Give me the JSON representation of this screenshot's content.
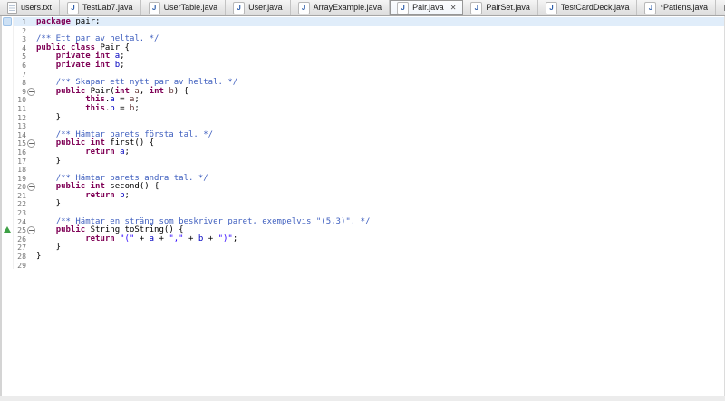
{
  "tabbar": {
    "tabs": [
      {
        "label": "users.txt",
        "icon": "text-file",
        "active": false
      },
      {
        "label": "TestLab7.java",
        "icon": "java-file",
        "active": false
      },
      {
        "label": "UserTable.java",
        "icon": "java-file",
        "active": false
      },
      {
        "label": "User.java",
        "icon": "java-file",
        "active": false
      },
      {
        "label": "ArrayExample.java",
        "icon": "java-file",
        "active": false
      },
      {
        "label": "Pair.java",
        "icon": "java-file",
        "active": true,
        "closable": true
      },
      {
        "label": "PairSet.java",
        "icon": "java-file",
        "active": false
      },
      {
        "label": "TestCardDeck.java",
        "icon": "java-file",
        "active": false
      },
      {
        "label": "*Patiens.java",
        "icon": "java-file",
        "active": false,
        "dirty": true
      }
    ],
    "window_controls": [
      "minimize",
      "maximize"
    ]
  },
  "icons": {
    "java_glyph": "J",
    "close_glyph": "✕"
  },
  "colors": {
    "keyword": "#7f0055",
    "javadoc": "#3f5fbf",
    "string": "#2a00ff",
    "field": "#0000c0",
    "parameter": "#6a3e3e",
    "current_line_highlight": "#e0edfa",
    "line_number": "#777777",
    "override_marker_green": "#3da045"
  },
  "editor": {
    "language": "java",
    "file": "Pair.java",
    "current_line": 1,
    "lines": [
      {
        "n": 1,
        "highlight": true,
        "marker": "edit",
        "tokens": [
          [
            "kw",
            "package"
          ],
          [
            "plain",
            " pair;"
          ]
        ]
      },
      {
        "n": 2,
        "tokens": []
      },
      {
        "n": 3,
        "tokens": [
          [
            "doc",
            "/** Ett par av heltal. */"
          ]
        ]
      },
      {
        "n": 4,
        "tokens": [
          [
            "kw",
            "public"
          ],
          [
            "plain",
            " "
          ],
          [
            "kw",
            "class"
          ],
          [
            "plain",
            " Pair {"
          ]
        ]
      },
      {
        "n": 5,
        "tokens": [
          [
            "plain",
            "    "
          ],
          [
            "kw",
            "private"
          ],
          [
            "plain",
            " "
          ],
          [
            "kw",
            "int"
          ],
          [
            "plain",
            " "
          ],
          [
            "field",
            "a"
          ],
          [
            "plain",
            ";"
          ]
        ]
      },
      {
        "n": 6,
        "tokens": [
          [
            "plain",
            "    "
          ],
          [
            "kw",
            "private"
          ],
          [
            "plain",
            " "
          ],
          [
            "kw",
            "int"
          ],
          [
            "plain",
            " "
          ],
          [
            "field",
            "b"
          ],
          [
            "plain",
            ";"
          ]
        ]
      },
      {
        "n": 7,
        "tokens": []
      },
      {
        "n": 8,
        "tokens": [
          [
            "plain",
            "    "
          ],
          [
            "doc",
            "/** Skapar ett nytt par av heltal. */"
          ]
        ]
      },
      {
        "n": 9,
        "fold": true,
        "tokens": [
          [
            "plain",
            "    "
          ],
          [
            "kw",
            "public"
          ],
          [
            "plain",
            " Pair("
          ],
          [
            "kw",
            "int"
          ],
          [
            "plain",
            " "
          ],
          [
            "param",
            "a"
          ],
          [
            "plain",
            ", "
          ],
          [
            "kw",
            "int"
          ],
          [
            "plain",
            " "
          ],
          [
            "param",
            "b"
          ],
          [
            "plain",
            ") {"
          ]
        ]
      },
      {
        "n": 10,
        "tokens": [
          [
            "plain",
            "          "
          ],
          [
            "kw",
            "this"
          ],
          [
            "plain",
            "."
          ],
          [
            "field",
            "a"
          ],
          [
            "plain",
            " = "
          ],
          [
            "param",
            "a"
          ],
          [
            "plain",
            ";"
          ]
        ]
      },
      {
        "n": 11,
        "tokens": [
          [
            "plain",
            "          "
          ],
          [
            "kw",
            "this"
          ],
          [
            "plain",
            "."
          ],
          [
            "field",
            "b"
          ],
          [
            "plain",
            " = "
          ],
          [
            "param",
            "b"
          ],
          [
            "plain",
            ";"
          ]
        ]
      },
      {
        "n": 12,
        "tokens": [
          [
            "plain",
            "    }"
          ]
        ]
      },
      {
        "n": 13,
        "tokens": []
      },
      {
        "n": 14,
        "tokens": [
          [
            "plain",
            "    "
          ],
          [
            "doc",
            "/** Hämtar parets första tal. */"
          ]
        ]
      },
      {
        "n": 15,
        "fold": true,
        "tokens": [
          [
            "plain",
            "    "
          ],
          [
            "kw",
            "public"
          ],
          [
            "plain",
            " "
          ],
          [
            "kw",
            "int"
          ],
          [
            "plain",
            " first() {"
          ]
        ]
      },
      {
        "n": 16,
        "tokens": [
          [
            "plain",
            "          "
          ],
          [
            "kw",
            "return"
          ],
          [
            "plain",
            " "
          ],
          [
            "field",
            "a"
          ],
          [
            "plain",
            ";"
          ]
        ]
      },
      {
        "n": 17,
        "tokens": [
          [
            "plain",
            "    }"
          ]
        ]
      },
      {
        "n": 18,
        "tokens": []
      },
      {
        "n": 19,
        "tokens": [
          [
            "plain",
            "    "
          ],
          [
            "doc",
            "/** Hämtar parets andra tal. */"
          ]
        ]
      },
      {
        "n": 20,
        "fold": true,
        "tokens": [
          [
            "plain",
            "    "
          ],
          [
            "kw",
            "public"
          ],
          [
            "plain",
            " "
          ],
          [
            "kw",
            "int"
          ],
          [
            "plain",
            " second() {"
          ]
        ]
      },
      {
        "n": 21,
        "tokens": [
          [
            "plain",
            "          "
          ],
          [
            "kw",
            "return"
          ],
          [
            "plain",
            " "
          ],
          [
            "field",
            "b"
          ],
          [
            "plain",
            ";"
          ]
        ]
      },
      {
        "n": 22,
        "tokens": [
          [
            "plain",
            "    }"
          ]
        ]
      },
      {
        "n": 23,
        "tokens": []
      },
      {
        "n": 24,
        "tokens": [
          [
            "plain",
            "    "
          ],
          [
            "doc",
            "/** Hämtar en sträng som beskriver paret, exempelvis \"(5,3)\". */"
          ]
        ]
      },
      {
        "n": 25,
        "fold": true,
        "marker": "override",
        "tokens": [
          [
            "plain",
            "    "
          ],
          [
            "kw",
            "public"
          ],
          [
            "plain",
            " String toString() {"
          ]
        ]
      },
      {
        "n": 26,
        "tokens": [
          [
            "plain",
            "          "
          ],
          [
            "kw",
            "return"
          ],
          [
            "plain",
            " "
          ],
          [
            "str",
            "\"(\""
          ],
          [
            "plain",
            " + "
          ],
          [
            "field",
            "a"
          ],
          [
            "plain",
            " + "
          ],
          [
            "str",
            "\",\""
          ],
          [
            "plain",
            " + "
          ],
          [
            "field",
            "b"
          ],
          [
            "plain",
            " + "
          ],
          [
            "str",
            "\")\""
          ],
          [
            "plain",
            ";"
          ]
        ]
      },
      {
        "n": 27,
        "tokens": [
          [
            "plain",
            "    }"
          ]
        ]
      },
      {
        "n": 28,
        "tokens": [
          [
            "plain",
            "}"
          ]
        ]
      },
      {
        "n": 29,
        "tokens": []
      }
    ]
  }
}
